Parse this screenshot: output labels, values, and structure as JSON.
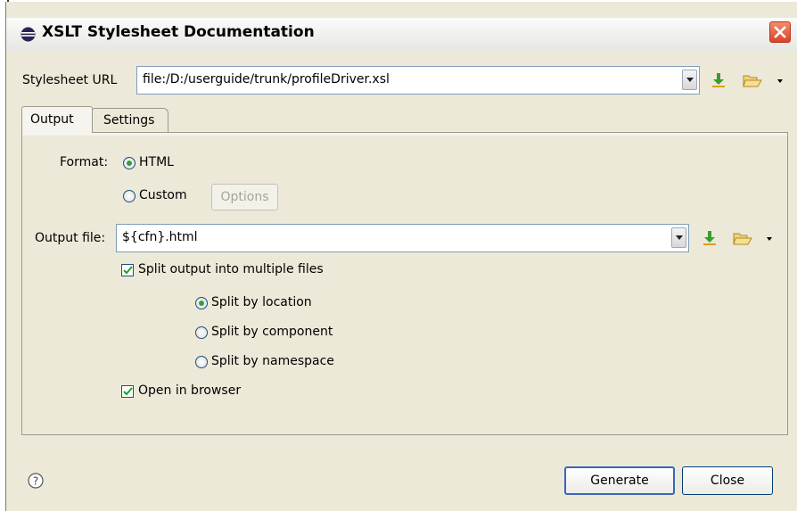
{
  "window": {
    "title": "XSLT Stylesheet Documentation"
  },
  "stylesheet": {
    "label": "Stylesheet URL",
    "value": "file:/D:/userguide/trunk/profileDriver.xsl"
  },
  "tabs": [
    {
      "label": "Output"
    },
    {
      "label": "Settings"
    }
  ],
  "format": {
    "label": "Format:",
    "html_label": "HTML",
    "custom_label": "Custom",
    "options_label": "Options",
    "selected": "HTML"
  },
  "output_file": {
    "label": "Output file:",
    "value": "${cfn}.html"
  },
  "split": {
    "label": "Split output into multiple files",
    "checked": true,
    "options": [
      {
        "label": "Split by location",
        "selected": true
      },
      {
        "label": "Split by component",
        "selected": false
      },
      {
        "label": "Split by namespace",
        "selected": false
      }
    ]
  },
  "open_in_browser": {
    "label": "Open in browser",
    "checked": true
  },
  "footer": {
    "generate_label": "Generate",
    "close_label": "Close"
  },
  "icons": {
    "app": "eclipse-icon",
    "close": "close-icon",
    "download": "download-arrow-icon",
    "folder": "open-folder-icon",
    "help": "help-icon"
  },
  "colors": {
    "close_button": "#e45a3c",
    "download_icon": "#3a9c2e",
    "folder_icon": "#f2c94c",
    "radio_dot": "#2ea33a"
  }
}
